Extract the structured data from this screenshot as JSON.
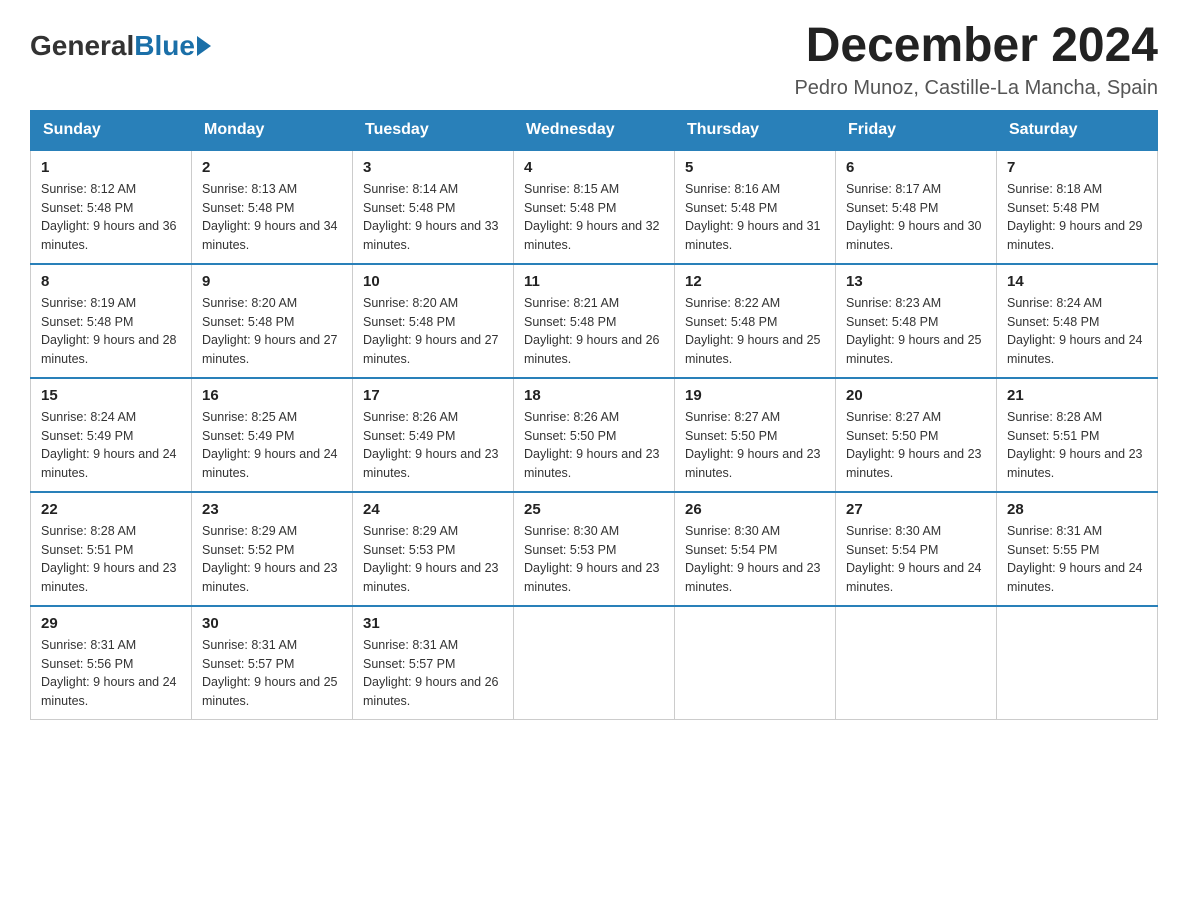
{
  "logo": {
    "general": "General",
    "blue": "Blue"
  },
  "title": {
    "month": "December 2024",
    "location": "Pedro Munoz, Castille-La Mancha, Spain"
  },
  "weekdays": [
    "Sunday",
    "Monday",
    "Tuesday",
    "Wednesday",
    "Thursday",
    "Friday",
    "Saturday"
  ],
  "weeks": [
    [
      {
        "day": "1",
        "sunrise": "8:12 AM",
        "sunset": "5:48 PM",
        "daylight": "9 hours and 36 minutes."
      },
      {
        "day": "2",
        "sunrise": "8:13 AM",
        "sunset": "5:48 PM",
        "daylight": "9 hours and 34 minutes."
      },
      {
        "day": "3",
        "sunrise": "8:14 AM",
        "sunset": "5:48 PM",
        "daylight": "9 hours and 33 minutes."
      },
      {
        "day": "4",
        "sunrise": "8:15 AM",
        "sunset": "5:48 PM",
        "daylight": "9 hours and 32 minutes."
      },
      {
        "day": "5",
        "sunrise": "8:16 AM",
        "sunset": "5:48 PM",
        "daylight": "9 hours and 31 minutes."
      },
      {
        "day": "6",
        "sunrise": "8:17 AM",
        "sunset": "5:48 PM",
        "daylight": "9 hours and 30 minutes."
      },
      {
        "day": "7",
        "sunrise": "8:18 AM",
        "sunset": "5:48 PM",
        "daylight": "9 hours and 29 minutes."
      }
    ],
    [
      {
        "day": "8",
        "sunrise": "8:19 AM",
        "sunset": "5:48 PM",
        "daylight": "9 hours and 28 minutes."
      },
      {
        "day": "9",
        "sunrise": "8:20 AM",
        "sunset": "5:48 PM",
        "daylight": "9 hours and 27 minutes."
      },
      {
        "day": "10",
        "sunrise": "8:20 AM",
        "sunset": "5:48 PM",
        "daylight": "9 hours and 27 minutes."
      },
      {
        "day": "11",
        "sunrise": "8:21 AM",
        "sunset": "5:48 PM",
        "daylight": "9 hours and 26 minutes."
      },
      {
        "day": "12",
        "sunrise": "8:22 AM",
        "sunset": "5:48 PM",
        "daylight": "9 hours and 25 minutes."
      },
      {
        "day": "13",
        "sunrise": "8:23 AM",
        "sunset": "5:48 PM",
        "daylight": "9 hours and 25 minutes."
      },
      {
        "day": "14",
        "sunrise": "8:24 AM",
        "sunset": "5:48 PM",
        "daylight": "9 hours and 24 minutes."
      }
    ],
    [
      {
        "day": "15",
        "sunrise": "8:24 AM",
        "sunset": "5:49 PM",
        "daylight": "9 hours and 24 minutes."
      },
      {
        "day": "16",
        "sunrise": "8:25 AM",
        "sunset": "5:49 PM",
        "daylight": "9 hours and 24 minutes."
      },
      {
        "day": "17",
        "sunrise": "8:26 AM",
        "sunset": "5:49 PM",
        "daylight": "9 hours and 23 minutes."
      },
      {
        "day": "18",
        "sunrise": "8:26 AM",
        "sunset": "5:50 PM",
        "daylight": "9 hours and 23 minutes."
      },
      {
        "day": "19",
        "sunrise": "8:27 AM",
        "sunset": "5:50 PM",
        "daylight": "9 hours and 23 minutes."
      },
      {
        "day": "20",
        "sunrise": "8:27 AM",
        "sunset": "5:50 PM",
        "daylight": "9 hours and 23 minutes."
      },
      {
        "day": "21",
        "sunrise": "8:28 AM",
        "sunset": "5:51 PM",
        "daylight": "9 hours and 23 minutes."
      }
    ],
    [
      {
        "day": "22",
        "sunrise": "8:28 AM",
        "sunset": "5:51 PM",
        "daylight": "9 hours and 23 minutes."
      },
      {
        "day": "23",
        "sunrise": "8:29 AM",
        "sunset": "5:52 PM",
        "daylight": "9 hours and 23 minutes."
      },
      {
        "day": "24",
        "sunrise": "8:29 AM",
        "sunset": "5:53 PM",
        "daylight": "9 hours and 23 minutes."
      },
      {
        "day": "25",
        "sunrise": "8:30 AM",
        "sunset": "5:53 PM",
        "daylight": "9 hours and 23 minutes."
      },
      {
        "day": "26",
        "sunrise": "8:30 AM",
        "sunset": "5:54 PM",
        "daylight": "9 hours and 23 minutes."
      },
      {
        "day": "27",
        "sunrise": "8:30 AM",
        "sunset": "5:54 PM",
        "daylight": "9 hours and 24 minutes."
      },
      {
        "day": "28",
        "sunrise": "8:31 AM",
        "sunset": "5:55 PM",
        "daylight": "9 hours and 24 minutes."
      }
    ],
    [
      {
        "day": "29",
        "sunrise": "8:31 AM",
        "sunset": "5:56 PM",
        "daylight": "9 hours and 24 minutes."
      },
      {
        "day": "30",
        "sunrise": "8:31 AM",
        "sunset": "5:57 PM",
        "daylight": "9 hours and 25 minutes."
      },
      {
        "day": "31",
        "sunrise": "8:31 AM",
        "sunset": "5:57 PM",
        "daylight": "9 hours and 26 minutes."
      },
      null,
      null,
      null,
      null
    ]
  ]
}
